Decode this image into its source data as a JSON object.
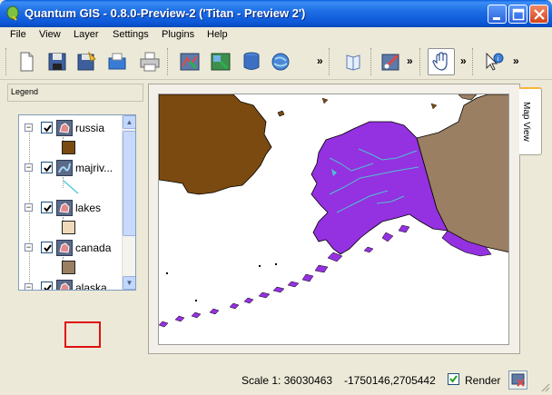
{
  "window": {
    "title": "Quantum GIS - 0.8.0-Preview-2 ('Titan - Preview 2')",
    "app_icon": "qgis-logo-icon"
  },
  "menu": [
    "File",
    "View",
    "Layer",
    "Settings",
    "Plugins",
    "Help"
  ],
  "toolbar": {
    "groups": [
      [
        "new-project-icon",
        "save-project-icon",
        "save-as-icon",
        "open-project-icon",
        "print-icon"
      ],
      [
        "add-vector-layer-icon",
        "add-raster-layer-icon",
        "add-postgis-layer-icon",
        "add-wms-layer-icon"
      ],
      [
        "help-book-icon"
      ],
      [
        "capture-point-icon"
      ],
      [
        "pan-hand-icon"
      ],
      [
        "identify-icon"
      ]
    ],
    "overflow_label": "»",
    "active_tool": "pan-hand-icon"
  },
  "legend": {
    "title": "Legend",
    "layers": [
      {
        "name": "russia",
        "visible": true,
        "symbol_color": "#7b4a10"
      },
      {
        "name": "majrivers",
        "display_name": "majriv...",
        "visible": true,
        "symbol_type": "line",
        "symbol_color": "#47c6d8"
      },
      {
        "name": "lakes",
        "visible": true,
        "symbol_color": "#efd9b8"
      },
      {
        "name": "canada",
        "visible": true,
        "symbol_color": "#9a7f62"
      },
      {
        "name": "alaska",
        "display_name": "alaska",
        "visible": true,
        "symbol_color": "#8b2be0"
      }
    ],
    "expander_glyph": "−"
  },
  "map_view": {
    "tab_label": "Map View",
    "colors": {
      "russia": "#7b4a10",
      "canada": "#9a7f62",
      "alaska": "#9431e0",
      "rivers": "#4fc2cf",
      "background": "#ffffff"
    }
  },
  "status": {
    "scale": "Scale 1: 36030463",
    "coordinates": "-1750146,2705442",
    "render_label": "Render",
    "render_checked": true
  }
}
